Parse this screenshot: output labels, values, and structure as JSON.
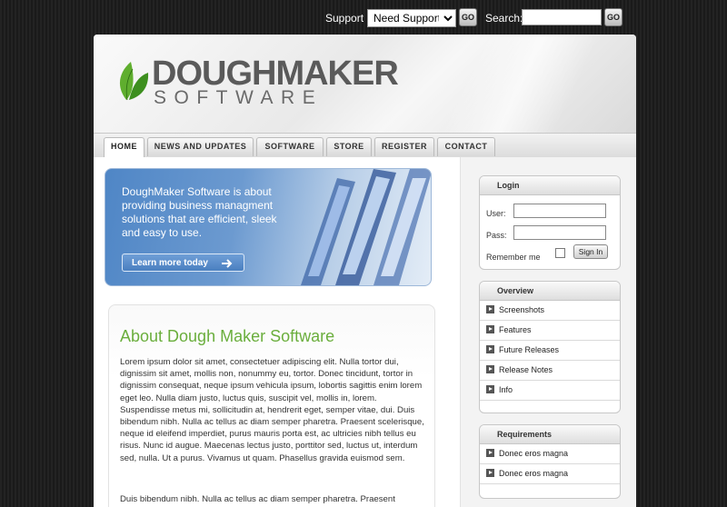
{
  "topbar": {
    "support_label": "Support",
    "support_selected": "Need Support?",
    "go_label": "GO",
    "search_label": "Search:",
    "search_value": ""
  },
  "logo": {
    "line1": "DOUGHMAKER",
    "line2": "SOFTWARE"
  },
  "nav": {
    "home": "HOME",
    "news": "NEWS AND UPDATES",
    "software": "SOFTWARE",
    "store": "STORE",
    "register": "REGISTER",
    "contact": "CONTACT"
  },
  "promo": {
    "text": "DoughMaker Software is about providing business managment solutions that are efficient, sleek and easy to use.",
    "button": "Learn more today"
  },
  "about": {
    "title": "About Dough Maker Software",
    "paragraph1": "Lorem ipsum dolor sit amet, consectetuer adipiscing elit. Nulla tortor dui, dignissim sit amet, mollis non, nonummy eu, tortor. Donec tincidunt, tortor in dignissim consequat, neque ipsum vehicula ipsum, lobortis sagittis enim lorem eget leo. Nulla diam justo, luctus quis, suscipit vel, mollis in, lorem. Suspendisse metus mi, sollicitudin at, hendrerit eget, semper vitae, dui. Duis bibendum nibh. Nulla ac tellus ac diam semper pharetra. Praesent scelerisque, neque id eleifend imperdiet, purus mauris porta est, ac ultricies nibh tellus eu risus. Nunc id augue. Maecenas lectus justo, porttitor sed, luctus ut, interdum sed, nulla. Ut a purus. Vivamus ut quam. Phasellus gravida euismod sem.",
    "paragraph2": "Duis bibendum nibh. Nulla ac tellus ac diam semper pharetra. Praesent"
  },
  "login": {
    "title": "Login",
    "user_label": "User:",
    "pass_label": "Pass:",
    "remember_label": "Remember me",
    "signin_label": "Sign In"
  },
  "overview": {
    "title": "Overview",
    "items": [
      "Screenshots",
      "Features",
      "Future Releases",
      "Release Notes",
      "Info"
    ]
  },
  "requirements": {
    "title": "Requirements",
    "items": [
      "Donec eros magna",
      "Donec eros magna"
    ]
  }
}
